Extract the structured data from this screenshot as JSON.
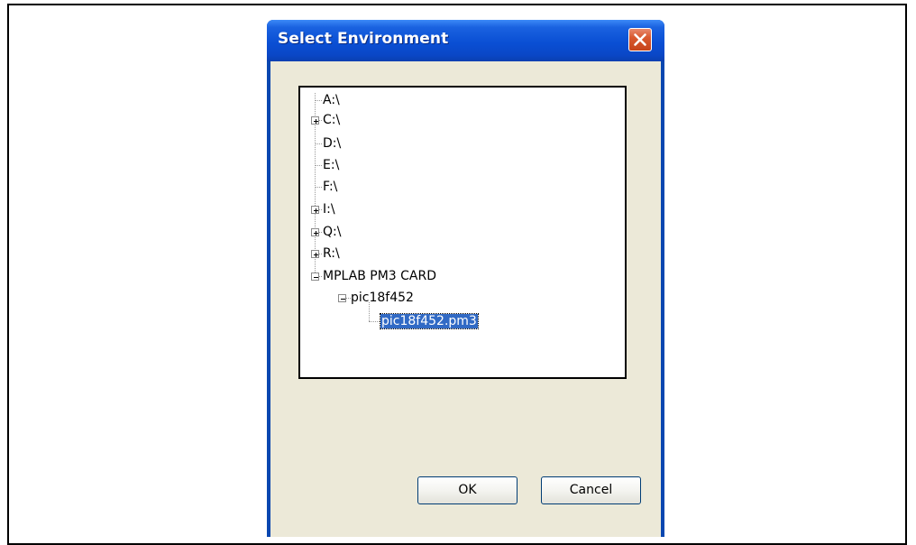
{
  "dialog": {
    "title": "Select Environment",
    "close_icon": "close-icon",
    "ok_label": "OK",
    "cancel_label": "Cancel"
  },
  "tree": {
    "nodes": [
      {
        "label": "A:\\",
        "expander": "none"
      },
      {
        "label": "C:\\",
        "expander": "plus"
      },
      {
        "label": "D:\\",
        "expander": "none"
      },
      {
        "label": "E:\\",
        "expander": "none"
      },
      {
        "label": "F:\\",
        "expander": "none"
      },
      {
        "label": "I:\\",
        "expander": "plus"
      },
      {
        "label": "Q:\\",
        "expander": "plus"
      },
      {
        "label": "R:\\",
        "expander": "plus"
      },
      {
        "label": "MPLAB PM3 CARD",
        "expander": "minus"
      },
      {
        "label": "pic18f452",
        "expander": "minus"
      },
      {
        "label": "pic18f452.pm3",
        "expander": "none",
        "selected": true
      }
    ]
  },
  "colors": {
    "title_bar": "#0a4fd4",
    "dialog_face": "#ece9d8",
    "selection": "#316ac5",
    "close_button": "#d9592f"
  }
}
